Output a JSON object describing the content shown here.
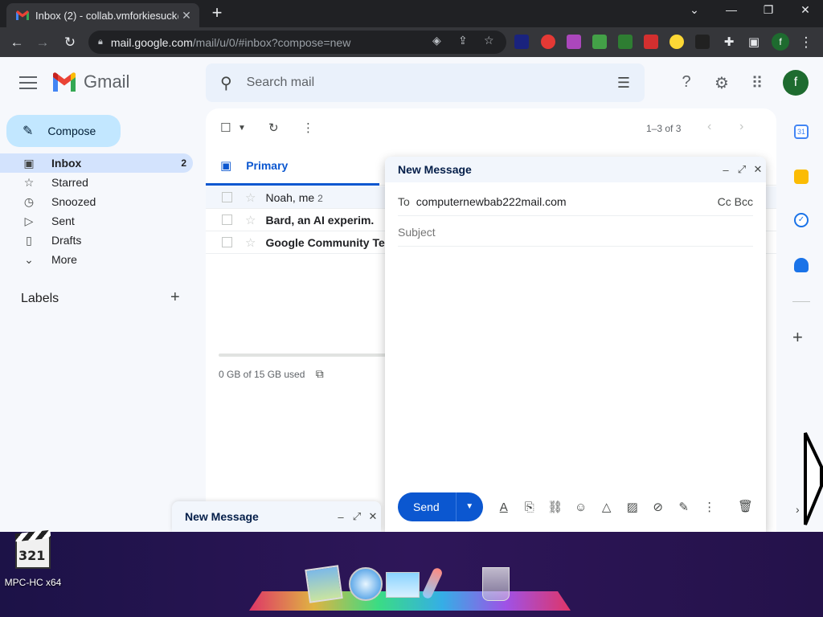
{
  "browser": {
    "tab_title": "Inbox (2) - collab.vmforkiesuck@",
    "tab_close": "✕",
    "new_tab": "+",
    "url_host": "mail.google.com",
    "url_path": "/mail/u/0/#inbox?compose=new",
    "profile_initial": "f"
  },
  "gmail": {
    "brand": "Gmail",
    "search_placeholder": "Search mail",
    "avatar_initial": "f",
    "compose_label": "Compose",
    "nav": [
      {
        "label": "Inbox",
        "count": "2",
        "icon": "inbox-icon"
      },
      {
        "label": "Starred",
        "icon": "star-icon"
      },
      {
        "label": "Snoozed",
        "icon": "clock-icon"
      },
      {
        "label": "Sent",
        "icon": "send-icon"
      },
      {
        "label": "Drafts",
        "icon": "draft-icon"
      },
      {
        "label": "More",
        "icon": "chevron-down-icon"
      }
    ],
    "labels_heading": "Labels",
    "pager": "1–3 of 3",
    "tab_primary": "Primary",
    "emails": [
      {
        "sender": "Noah, me",
        "count": "2",
        "unread": false
      },
      {
        "sender": "Bard, an AI experim.",
        "unread": true
      },
      {
        "sender": "Google Community Te",
        "unread": true
      }
    ],
    "storage": "0 GB of 15 GB used"
  },
  "compose": {
    "title": "New Message",
    "to_label": "To",
    "to_value": "computernewbab222mail.com",
    "cc_bcc": "Cc Bcc",
    "subject_placeholder": "Subject",
    "send_label": "Send"
  },
  "mini_compose": {
    "title": "New Message"
  },
  "desktop": {
    "app_label": "MPC-HC x64",
    "app_icon_text": "321"
  },
  "colors": {
    "primary_blue": "#0b57d0",
    "compose_button": "#c2e7ff",
    "active_nav": "#d3e3fd",
    "avatar_green": "#1e6b2f"
  }
}
